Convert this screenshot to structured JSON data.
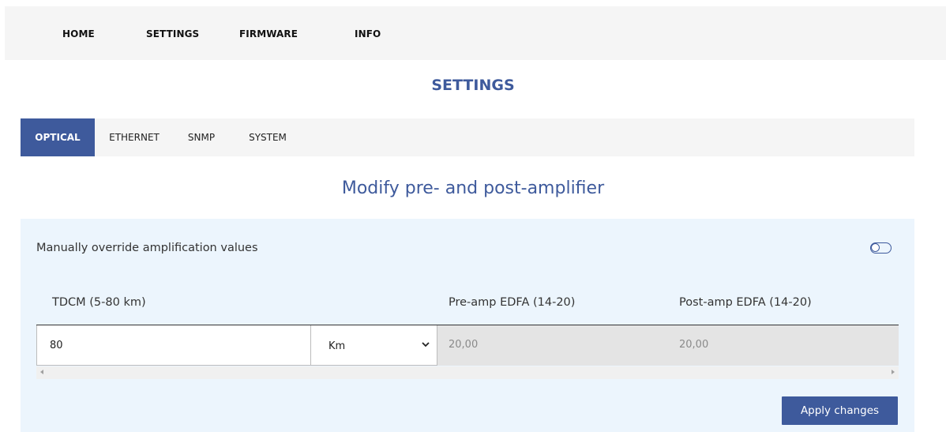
{
  "nav": {
    "items": [
      {
        "label": "HOME"
      },
      {
        "label": "SETTINGS"
      },
      {
        "label": "FIRMWARE"
      },
      {
        "label": "INFO"
      }
    ]
  },
  "page": {
    "title": "SETTINGS"
  },
  "tabs": [
    {
      "label": "OPTICAL",
      "active": true
    },
    {
      "label": "ETHERNET",
      "active": false
    },
    {
      "label": "SNMP",
      "active": false
    },
    {
      "label": "SYSTEM",
      "active": false
    }
  ],
  "optical": {
    "heading": "Modify pre- and post-amplifier",
    "override_label": "Manually override amplification values",
    "override_enabled": false,
    "columns": {
      "tdcm": "TDCM (5-80 km)",
      "pre_amp": "Pre-amp EDFA (14-20)",
      "post_amp": "Post-amp EDFA (14-20)"
    },
    "row": {
      "tdcm_value": "80",
      "unit": "Km",
      "pre_amp_value": "20,00",
      "post_amp_value": "20,00"
    },
    "apply_label": "Apply changes"
  },
  "colors": {
    "accent": "#3e5a9c",
    "nav_bg": "#f5f5f5",
    "panel_bg": "#ecf5fd",
    "readonly_bg": "#e4e4e4"
  }
}
